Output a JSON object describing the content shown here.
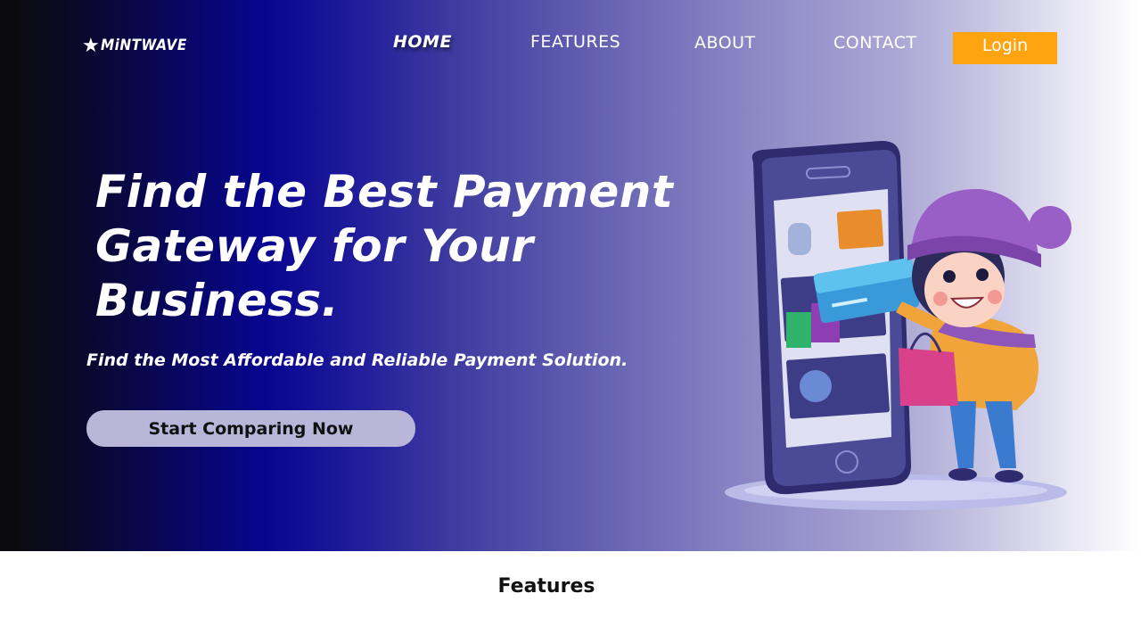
{
  "brand": {
    "star_icon": "star-icon",
    "name": "MiNTWAVE"
  },
  "nav": {
    "items": [
      {
        "label": "HOME",
        "active": true
      },
      {
        "label": "FEATURES",
        "active": false
      },
      {
        "label": "ABOUT",
        "active": false
      },
      {
        "label": "CONTACT",
        "active": false
      }
    ],
    "login_label": "Login"
  },
  "hero": {
    "title": "Find the Best Payment Gateway for Your Business.",
    "subtitle": "Find the Most Affordable and Reliable Payment Solution.",
    "cta_label": "Start Comparing Now",
    "illustration": "girl-shopping-with-phone-illustration"
  },
  "features": {
    "heading": "Features"
  },
  "colors": {
    "login_button": "#ffa411",
    "hero_blue": "#07058f",
    "cta_background": "#b8b6d9",
    "text_on_hero": "#ffffff"
  }
}
